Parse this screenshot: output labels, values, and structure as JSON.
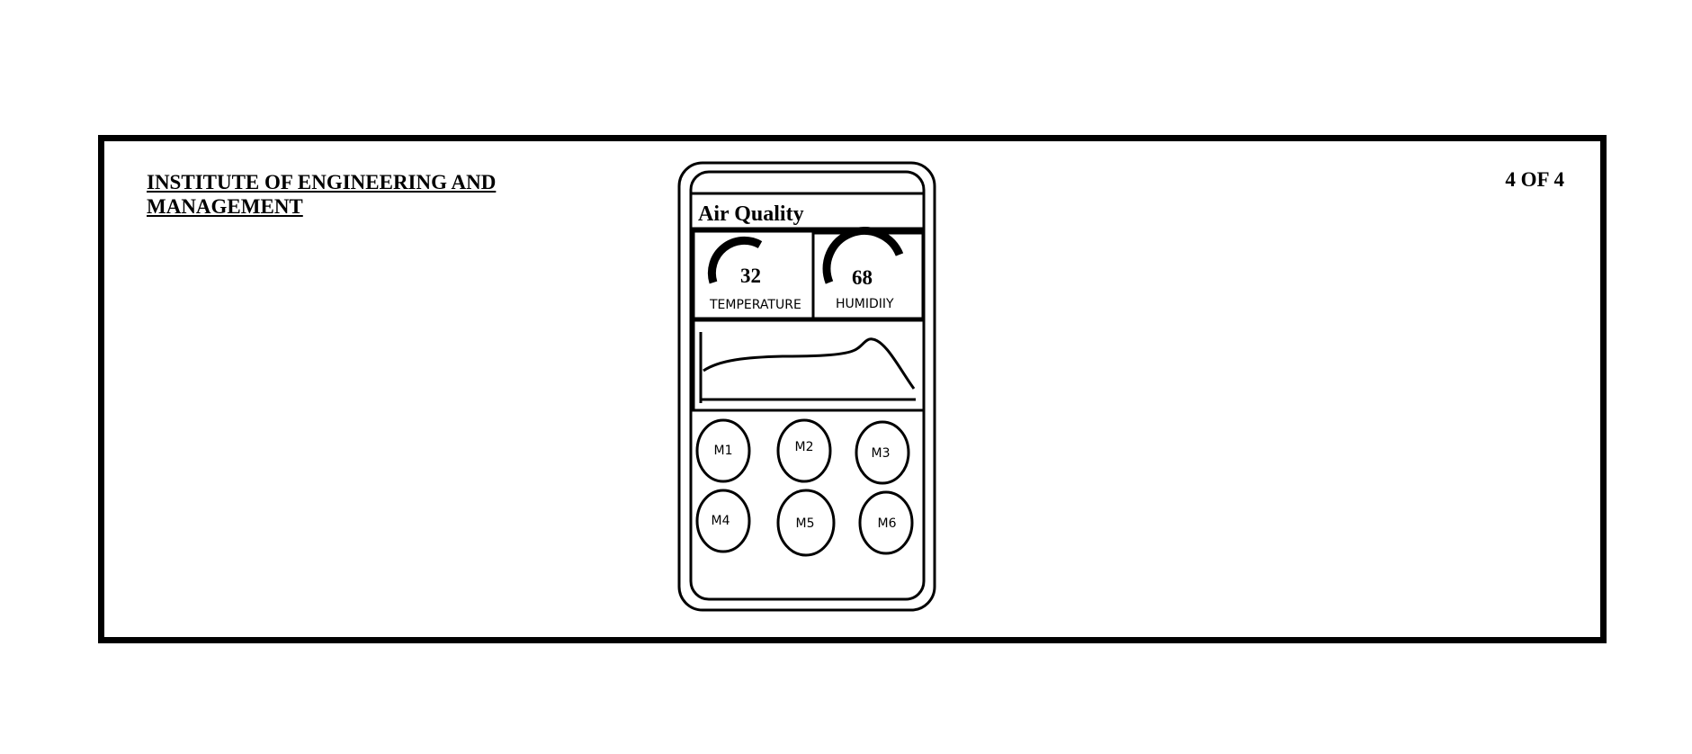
{
  "header": {
    "institute_line1": "INSTITUTE OF ENGINEERING AND",
    "institute_line2": "MANAGEMENT",
    "page_number": "4 OF 4"
  },
  "phone": {
    "screen_title": "Air Quality",
    "temperature": {
      "value": "32",
      "label": "TEMPERATURE"
    },
    "humidity": {
      "value": "68",
      "label": "HUMIDIIY"
    },
    "modes": [
      "M1",
      "M2",
      "M3",
      "M4",
      "M5",
      "M6"
    ]
  }
}
